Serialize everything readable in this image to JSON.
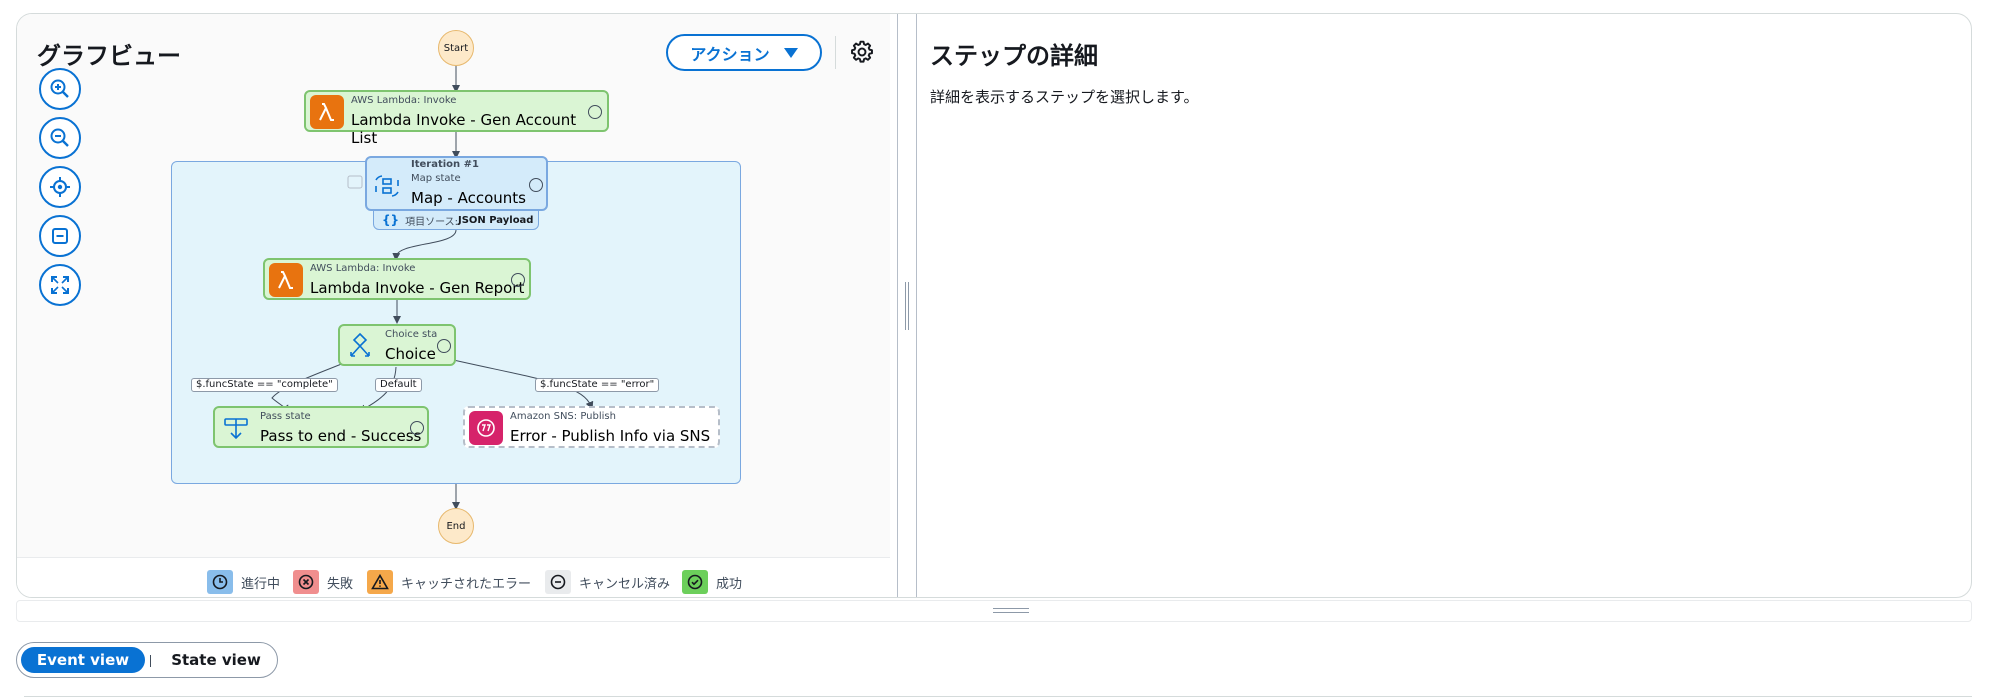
{
  "graph": {
    "title": "グラフビュー",
    "action_label": "アクション",
    "start_label": "Start",
    "end_label": "End"
  },
  "nodes": {
    "gen_account": {
      "type": "AWS Lambda: Invoke",
      "name": "Lambda Invoke - Gen Account List"
    },
    "map": {
      "iteration": "Iteration #1",
      "type": "Map state",
      "name": "Map - Accounts",
      "source_prefix": "項目ソース: ",
      "source_value": "JSON Payload"
    },
    "gen_report": {
      "type": "AWS Lambda: Invoke",
      "name": "Lambda Invoke - Gen Report"
    },
    "choice": {
      "type": "Choice sta",
      "name": "Choice"
    },
    "success": {
      "type": "Pass state",
      "name": "Pass to end - Success"
    },
    "error": {
      "type": "Amazon SNS: Publish",
      "name": "Error - Publish Info via SNS"
    }
  },
  "edges": {
    "complete": "$.funcState == \"complete\"",
    "default": "Default",
    "error": "$.funcState == \"error\""
  },
  "legend": [
    {
      "label": "進行中",
      "color": "#89bdeb",
      "icon": "clock-icon"
    },
    {
      "label": "失敗",
      "color": "#f08e8e",
      "icon": "x-circle-icon"
    },
    {
      "label": "キャッチされたエラー",
      "color": "#f5a84a",
      "icon": "warning-icon"
    },
    {
      "label": "キャンセル済み",
      "color": "#e9ebed",
      "icon": "minus-circle-icon"
    },
    {
      "label": "成功",
      "color": "#6ccf5b",
      "icon": "check-circle-icon"
    }
  ],
  "details": {
    "title": "ステップの詳細",
    "text": "詳細を表示するステップを選択します。"
  },
  "view_toggle": {
    "event_view": "Event view",
    "state_view": "State view"
  },
  "colors": {
    "accent": "#0972d3",
    "success_fill": "#daf5d4",
    "map_fill": "#e3f4fb",
    "lambda_orange": "#e8730f",
    "sns_pink": "#d6236a"
  }
}
